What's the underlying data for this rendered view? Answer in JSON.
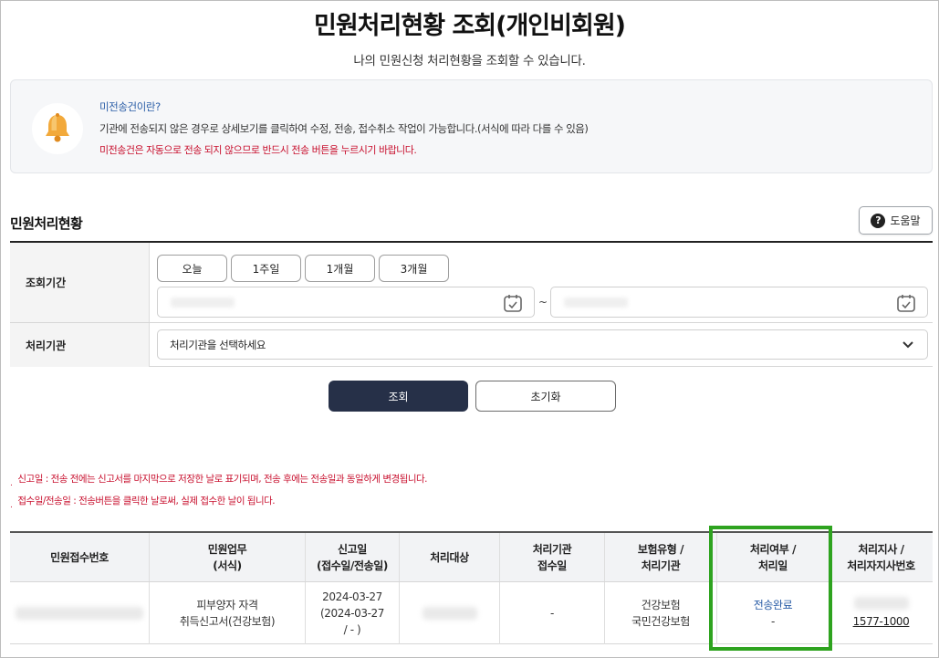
{
  "header": {
    "title": "민원처리현황 조회(개인비회원)",
    "subtitle": "나의 민원신청 처리현황을 조회할 수 있습니다."
  },
  "notice": {
    "icon": "bell-icon",
    "heading": "미전송건이란?",
    "body": "기관에 전송되지 않은 경우로 상세보기를 클릭하여 수정, 전송, 접수취소 작업이 가능합니다.(서식에 따라 다를 수 있음)",
    "warning": "미전송건은 자동으로 전송 되지 않으므로 반드시 전송 버튼을 누르시기 바랍니다."
  },
  "section": {
    "title": "민원처리현황",
    "help_label": "도움말",
    "help_icon": "question-circle-icon"
  },
  "filter": {
    "period_label": "조회기간",
    "period_buttons": [
      "오늘",
      "1주일",
      "1개월",
      "3개월"
    ],
    "date_from": "",
    "date_to": "",
    "range_separator": "~",
    "agency_label": "처리기관",
    "agency_placeholder": "처리기관을 선택하세요"
  },
  "actions": {
    "search_label": "조회",
    "reset_label": "초기화"
  },
  "notes": [
    "신고일 : 전송 전에는 신고서를 마지막으로 저장한 날로 표기되며, 전송 후에는 전송일과 동일하게 변경됩니다.",
    "접수일/전송일 : 전송버튼을 클릭한 날로써, 실제 접수한 날이 됩니다."
  ],
  "table": {
    "columns": [
      [
        "민원접수번호"
      ],
      [
        "민원업무",
        "(서식)"
      ],
      [
        "신고일",
        "(접수일/전송일)"
      ],
      [
        "처리대상"
      ],
      [
        "처리기관",
        "접수일"
      ],
      [
        "보험유형 /",
        "처리기관"
      ],
      [
        "처리여부 /",
        "처리일"
      ],
      [
        "처리지사 /",
        "처리자지사번호"
      ]
    ],
    "rows": [
      {
        "receipt_no": "",
        "task": [
          "피부양자 자격",
          "취득신고서(건강보험)"
        ],
        "report_date": [
          "2024-03-27",
          "(2024-03-27",
          "/ - )"
        ],
        "target": "",
        "agency_receipt_date": "-",
        "insurance": [
          "건강보험",
          "국민건강보험"
        ],
        "status": "전송완료",
        "status_date": "-",
        "branch_phone": "1577-1000"
      }
    ]
  },
  "colors": {
    "primary_button": "#263048",
    "link_blue": "#2b5ea7",
    "warning_red": "#c8102e",
    "highlight_green": "#2ea31f",
    "bell": "#f2a93b"
  }
}
